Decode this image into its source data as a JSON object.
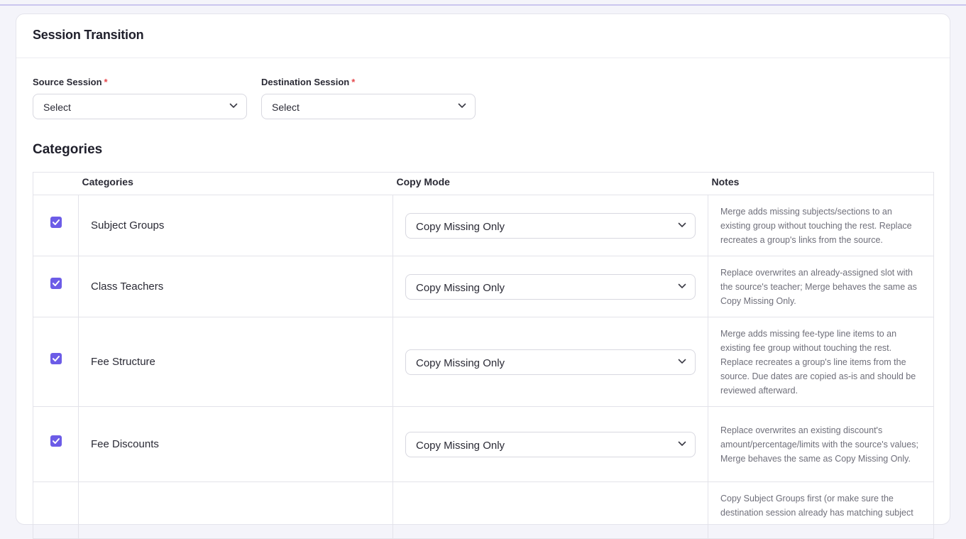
{
  "page": {
    "title": "Session Transition",
    "source_session": {
      "label": "Source Session",
      "required_mark": "*",
      "value": "Select"
    },
    "destination_session": {
      "label": "Destination Session",
      "required_mark": "*",
      "value": "Select"
    },
    "section_title": "Categories"
  },
  "table": {
    "headers": {
      "categories": "Categories",
      "copy_mode": "Copy Mode",
      "notes": "Notes"
    },
    "rows": [
      {
        "checked": true,
        "category": "Subject Groups",
        "copy_mode": "Copy Missing Only",
        "note": "Merge adds missing subjects/sections to an existing group without touching the rest. Replace recreates a group's links from the source."
      },
      {
        "checked": true,
        "category": "Class Teachers",
        "copy_mode": "Copy Missing Only",
        "note": "Replace overwrites an already-assigned slot with the source's teacher; Merge behaves the same as Copy Missing Only."
      },
      {
        "checked": true,
        "category": "Fee Structure",
        "copy_mode": "Copy Missing Only",
        "note": "Merge adds missing fee-type line items to an existing fee group without touching the rest. Replace recreates a group's line items from the source. Due dates are copied as-is and should be reviewed afterward."
      },
      {
        "checked": true,
        "category": "Fee Discounts",
        "copy_mode": "Copy Missing Only",
        "note": "Replace overwrites an existing discount's amount/percentage/limits with the source's values; Merge behaves the same as Copy Missing Only."
      },
      {
        "checked": false,
        "category": "",
        "copy_mode": "",
        "note": "Copy Subject Groups first (or make sure the destination session already has matching subject"
      }
    ]
  },
  "colors": {
    "accent": "#6c5ce7",
    "required": "#e5484d"
  },
  "icons": {
    "dropdown": "chevron-down-icon",
    "check": "checkmark-icon"
  }
}
